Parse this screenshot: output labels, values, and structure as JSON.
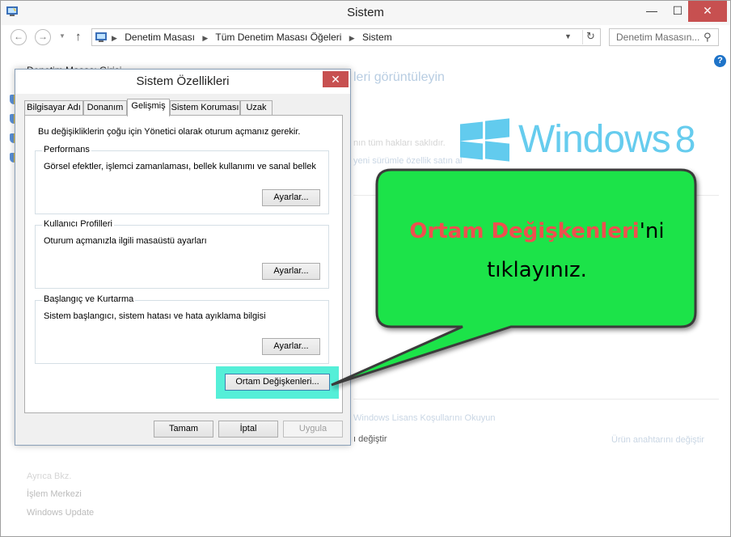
{
  "window": {
    "title": "Sistem",
    "minimize": "—",
    "maximize": "☐",
    "close": "✕"
  },
  "nav": {
    "back": "←",
    "forward": "→",
    "up": "↑",
    "breadcrumbs": [
      "Denetim Masası",
      "Tüm Denetim Masası Öğeleri",
      "Sistem"
    ],
    "search_placeholder": "Denetim Masasın..."
  },
  "background": {
    "cp_home": "Denetim Masası Girişi",
    "heading": "leri görüntüleyin",
    "links": [
      "Ayrıca Bkz.",
      "İşlem Merkezi",
      "Windows Update"
    ],
    "snippets": [
      "nın tüm hakları saklıdır.",
      "yeni sürümle özellik satın al",
      "Windows Lisans Koşullarını Okuyun",
      "Ürün anahtarını değiştir",
      "ı değiştir"
    ]
  },
  "logo": {
    "text": "Windows",
    "version": "8"
  },
  "dialog": {
    "title": "Sistem Özellikleri",
    "close": "✕",
    "tabs": [
      {
        "label": "Bilgisayar Adı",
        "active": false
      },
      {
        "label": "Donanım",
        "active": false
      },
      {
        "label": "Gelişmiş",
        "active": true
      },
      {
        "label": "Sistem Koruması",
        "active": false
      },
      {
        "label": "Uzak",
        "active": false
      }
    ],
    "note": "Bu değişikliklerin çoğu için Yönetici olarak oturum açmanız gerekir.",
    "groups": [
      {
        "title": "Performans",
        "desc": "Görsel efektler, işlemci zamanlaması, bellek kullanımı ve sanal bellek",
        "button": "Ayarlar..."
      },
      {
        "title": "Kullanıcı Profilleri",
        "desc": "Oturum açmanızla ilgili masaüstü ayarları",
        "button": "Ayarlar..."
      },
      {
        "title": "Başlangıç ve Kurtarma",
        "desc": "Sistem başlangıcı, sistem hatası ve hata ayıklama bilgisi",
        "button": "Ayarlar..."
      }
    ],
    "env_button": "Ortam Değişkenleri...",
    "ok": "Tamam",
    "cancel": "İptal",
    "apply": "Uygula"
  },
  "callout": {
    "highlight": "Ortam Değişkenleri",
    "rest_line1": "'ni",
    "line2": "tıklayınız.",
    "fill_color": "#1ee34a",
    "highlight_color": "#ef4f4f"
  }
}
